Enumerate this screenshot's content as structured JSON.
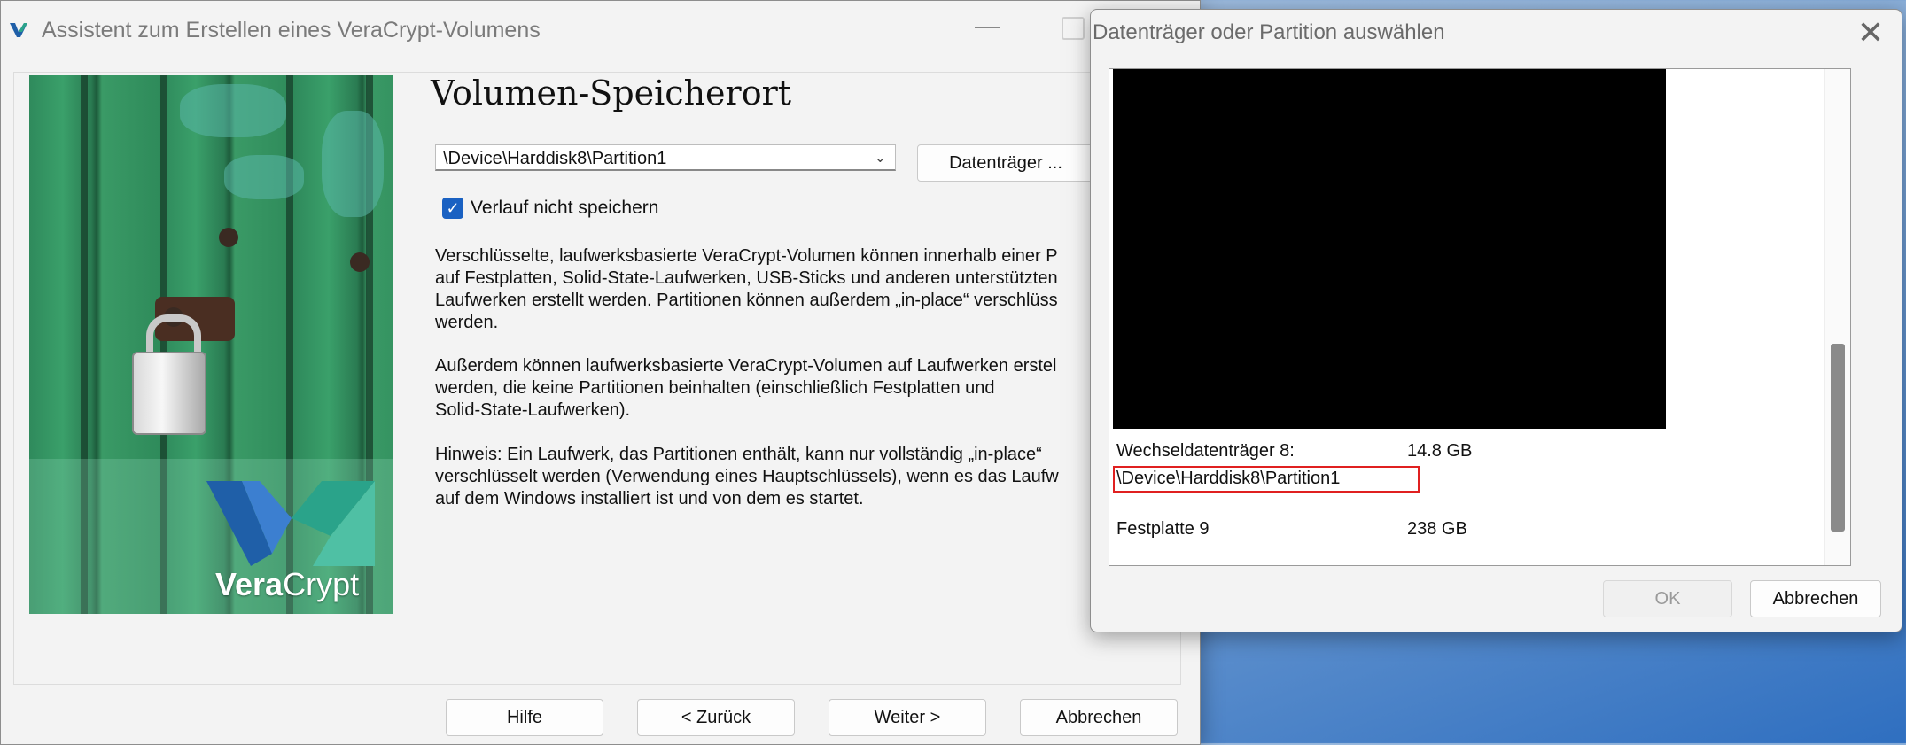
{
  "wizard": {
    "title": "Assistent zum Erstellen eines VeraCrypt-Volumens",
    "heading": "Volumen-Speicherort",
    "volume_path": "\\Device\\Harddisk8\\Partition1",
    "device_button": "Datenträger ...",
    "checkbox_label": "Verlauf nicht speichern",
    "checkbox_checked": true,
    "paragraph1": "Verschlüsselte, laufwerksbasierte VeraCrypt-Volumen können innerhalb einer P\nauf Festplatten, Solid-State-Laufwerken, USB-Sticks und anderen unterstützten\nLaufwerken erstellt werden. Partitionen können außerdem „in-place“ verschlüss\nwerden.",
    "paragraph2": "Außerdem können laufwerksbasierte VeraCrypt-Volumen auf Laufwerken erstel\nwerden, die keine Partitionen beinhalten (einschließlich Festplatten und\nSolid-State-Laufwerken).",
    "paragraph3": "Hinweis: Ein Laufwerk, das Partitionen enthält, kann nur vollständig „in-place“\nverschlüsselt werden (Verwendung eines Hauptschlüssels), wenn es das Laufw\nauf dem Windows installiert ist und von dem es startet.",
    "logo_text_bold": "Vera",
    "logo_text_light": "Crypt",
    "buttons": {
      "help": "Hilfe",
      "back": "< Zurück",
      "next": "Weiter >",
      "cancel": "Abbrechen"
    }
  },
  "dialog": {
    "title": "Datenträger oder Partition auswählen",
    "rows": [
      {
        "name": "Wechseldatenträger 8:",
        "size": "14.8 GB"
      },
      {
        "name": "\\Device\\Harddisk8\\Partition1",
        "size": ""
      },
      {
        "name": "Festplatte 9",
        "size": "238 GB"
      }
    ],
    "ok": "OK",
    "cancel": "Abbrechen"
  },
  "icons": {
    "app": "veracrypt-icon",
    "close": "close-icon",
    "minimize": "minimize-icon",
    "maximize": "maximize-icon",
    "dropdown": "chevron-down-icon",
    "check": "checkmark-icon"
  },
  "colors": {
    "accent": "#1a61c2",
    "highlight_border": "#e02020"
  }
}
